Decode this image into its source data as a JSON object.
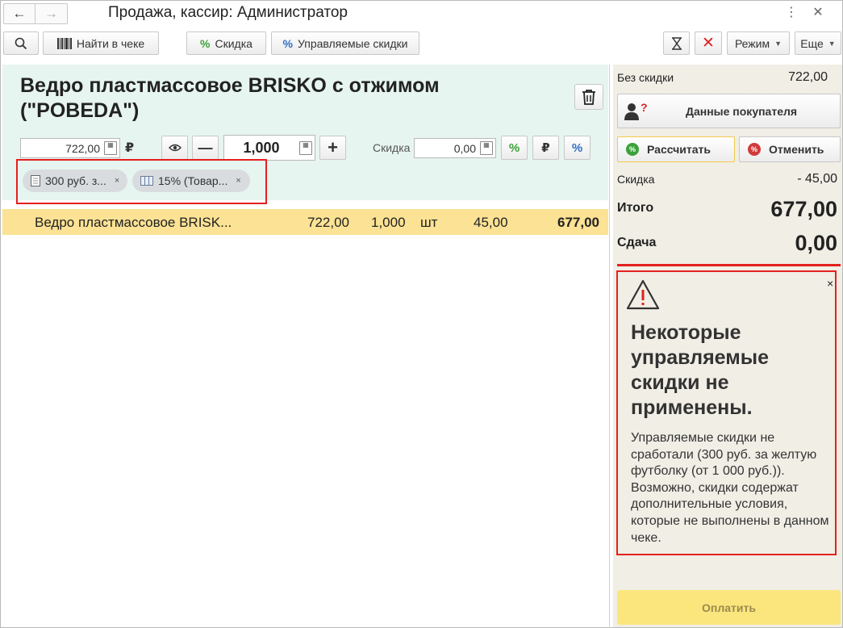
{
  "window": {
    "title": "Продажа, кассир: Администратор",
    "menu_icon": "kebab-icon",
    "close_icon": "close-icon"
  },
  "toolbar": {
    "search_icon": "search-icon",
    "find_in_receipt": "Найти в чеке",
    "discount": "Скидка",
    "managed_discounts": "Управляемые скидки",
    "mode": "Режим",
    "more": "Еще"
  },
  "product": {
    "name": "Ведро пластмассовое BRISKO с отжимом (\"POBEDA\")",
    "price": "722,00",
    "currency": "₽",
    "quantity": "1,000",
    "discount_label": "Скидка",
    "discount_value": "0,00"
  },
  "chips": [
    {
      "label": "300 руб. з...",
      "close": "×"
    },
    {
      "label": "15% (Товар...",
      "close": "×"
    }
  ],
  "receipt_rows": [
    {
      "name": "Ведро пластмассовое BRISK...",
      "price": "722,00",
      "qty": "1,000",
      "unit": "шт",
      "discount": "45,00",
      "total": "677,00"
    }
  ],
  "summary": {
    "no_discount_label": "Без скидки",
    "no_discount_value": "722,00",
    "customer_button": "Данные покупателя",
    "calculate": "Рассчитать",
    "cancel": "Отменить",
    "discount_label": "Скидка",
    "discount_value": "- 45,00",
    "total_label": "Итого",
    "total_value": "677,00",
    "change_label": "Сдача",
    "change_value": "0,00"
  },
  "warning": {
    "close": "×",
    "title": "Некоторые управляемые скидки не применены.",
    "text": "Управляемые скидки не сработали (300 руб. за желтую футболку (от 1 000 руб.)). Возможно, скидки содержат дополнительные условия, которые не выполнены в данном чеке."
  },
  "pay_button": "Оплатить",
  "colors": {
    "accent_green_bg": "#e6f5ef",
    "row_highlight": "#fbe294",
    "alert_red": "#e5201f",
    "pay_yellow": "#fbe67e"
  }
}
